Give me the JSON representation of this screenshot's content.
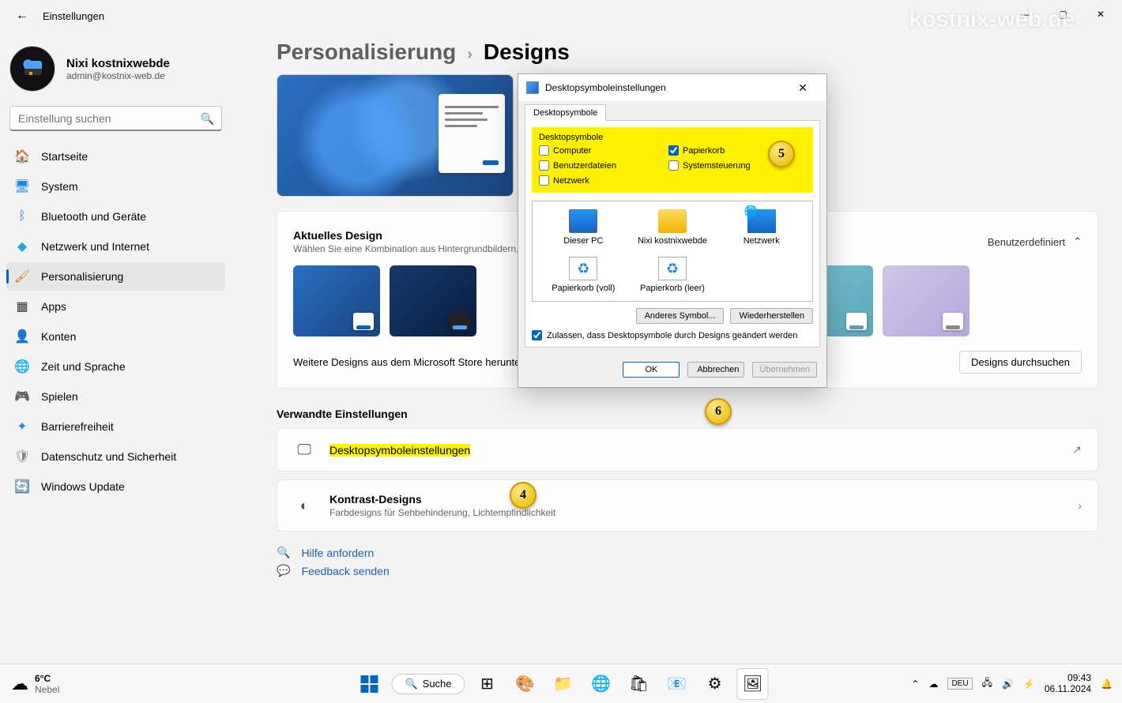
{
  "window": {
    "title": "Einstellungen",
    "watermark": "kostnix-web.de"
  },
  "user": {
    "name": "Nixi kostnixwebde",
    "email": "admin@kostnix-web.de"
  },
  "search": {
    "placeholder": "Einstellung suchen"
  },
  "nav": [
    {
      "label": "Startseite",
      "icon": "🏠",
      "color": "#c0392b"
    },
    {
      "label": "System",
      "icon": "🖥",
      "color": "#1e88e5"
    },
    {
      "label": "Bluetooth und Geräte",
      "icon": "ᛒ",
      "color": "#1e88e5"
    },
    {
      "label": "Netzwerk und Internet",
      "icon": "◆",
      "color": "#1ba9e0"
    },
    {
      "label": "Personalisierung",
      "icon": "🖌",
      "color": "#d97b00",
      "active": true
    },
    {
      "label": "Apps",
      "icon": "▦",
      "color": "#333"
    },
    {
      "label": "Konten",
      "icon": "👤",
      "color": "#e67e22"
    },
    {
      "label": "Zeit und Sprache",
      "icon": "🌐",
      "color": "#2e7d6b"
    },
    {
      "label": "Spielen",
      "icon": "🎮",
      "color": "#777"
    },
    {
      "label": "Barrierefreiheit",
      "icon": "✦",
      "color": "#1e88e5"
    },
    {
      "label": "Datenschutz und Sicherheit",
      "icon": "🛡",
      "color": "#888"
    },
    {
      "label": "Windows Update",
      "icon": "🔄",
      "color": "#1e88e5"
    }
  ],
  "breadcrumb": {
    "parent": "Personalisierung",
    "current": "Designs"
  },
  "themes": {
    "title": "Aktuelles Design",
    "subtitle": "Wählen Sie eine Kombination aus Hintergrundbildern, Sounds und Farben aus",
    "expand_label": "Benutzerdefiniert",
    "more": "Weitere Designs aus dem Microsoft Store herunterladen",
    "browse_btn": "Designs durchsuchen"
  },
  "related": {
    "heading": "Verwandte Einstellungen",
    "desktop_icons": "Desktopsymboleinstellungen",
    "contrast_title": "Kontrast-Designs",
    "contrast_sub": "Farbdesigns für Sehbehinderung, Lichtempfindlichkeit"
  },
  "help": {
    "ask": "Hilfe anfordern",
    "feedback": "Feedback senden"
  },
  "dialog": {
    "title": "Desktopsymboleinstellungen",
    "tab": "Desktopsymbole",
    "fieldset": "Desktopsymbole",
    "chk_computer": "Computer",
    "chk_userfiles": "Benutzerdateien",
    "chk_network": "Netzwerk",
    "chk_recycle": "Papierkorb",
    "chk_control": "Systemsteuerung",
    "icon_thispc": "Dieser PC",
    "icon_user": "Nixi kostnixwebde",
    "icon_network": "Netzwerk",
    "icon_bin_full": "Papierkorb (voll)",
    "icon_bin_empty": "Papierkorb (leer)",
    "btn_other": "Anderes Symbol...",
    "btn_restore": "Wiederherstellen",
    "perm": "Zulassen, dass Desktopsymbole durch Designs geändert werden",
    "ok": "OK",
    "cancel": "Abbrechen",
    "apply": "Übernehmen"
  },
  "annotations": {
    "a4": "4",
    "a5": "5",
    "a6": "6"
  },
  "taskbar": {
    "weather_temp": "6°C",
    "weather_desc": "Nebel",
    "search": "Suche",
    "lang": "DEU",
    "time": "09:43",
    "date": "06.11.2024"
  }
}
